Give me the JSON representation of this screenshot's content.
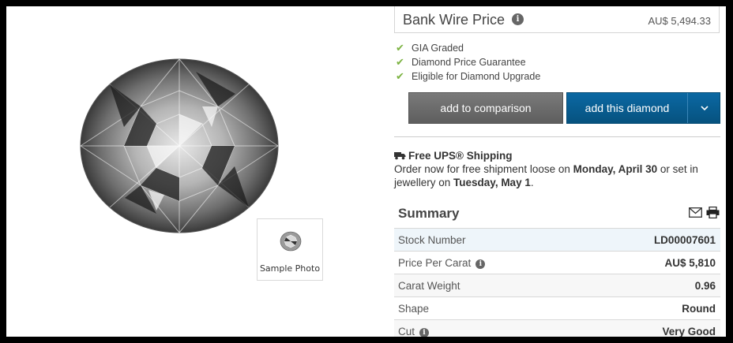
{
  "image": {
    "sample_caption": "Sample Photo"
  },
  "price": {
    "label": "Bank Wire Price",
    "value": "AU$ 5,494.33"
  },
  "features": [
    "GIA Graded",
    "Diamond Price Guarantee",
    "Eligible for Diamond Upgrade"
  ],
  "buttons": {
    "compare": "add to comparison",
    "add": "add this diamond"
  },
  "shipping": {
    "title": "Free UPS® Shipping",
    "line_prefix": "Order now for free shipment loose on ",
    "loose_date": "Monday, April 30",
    "line_middle": " or set in jewellery on ",
    "set_date": "Tuesday, May 1",
    "line_suffix": "."
  },
  "summary": {
    "title": "Summary",
    "rows": [
      {
        "label": "Stock Number",
        "value": "LD00007601"
      },
      {
        "label": "Price Per Carat",
        "value": "AU$ 5,810"
      },
      {
        "label": "Carat Weight",
        "value": "0.96"
      },
      {
        "label": "Shape",
        "value": "Round"
      },
      {
        "label": "Cut",
        "value": "Very Good"
      }
    ]
  },
  "colors": {
    "accent_blue": "#0b68a3",
    "compare_gray": "#6b6b6b",
    "check_green": "#7cb342"
  },
  "icons": [
    "info-icon",
    "check-icon",
    "truck-icon",
    "mail-icon",
    "print-icon",
    "chevron-down-icon"
  ]
}
